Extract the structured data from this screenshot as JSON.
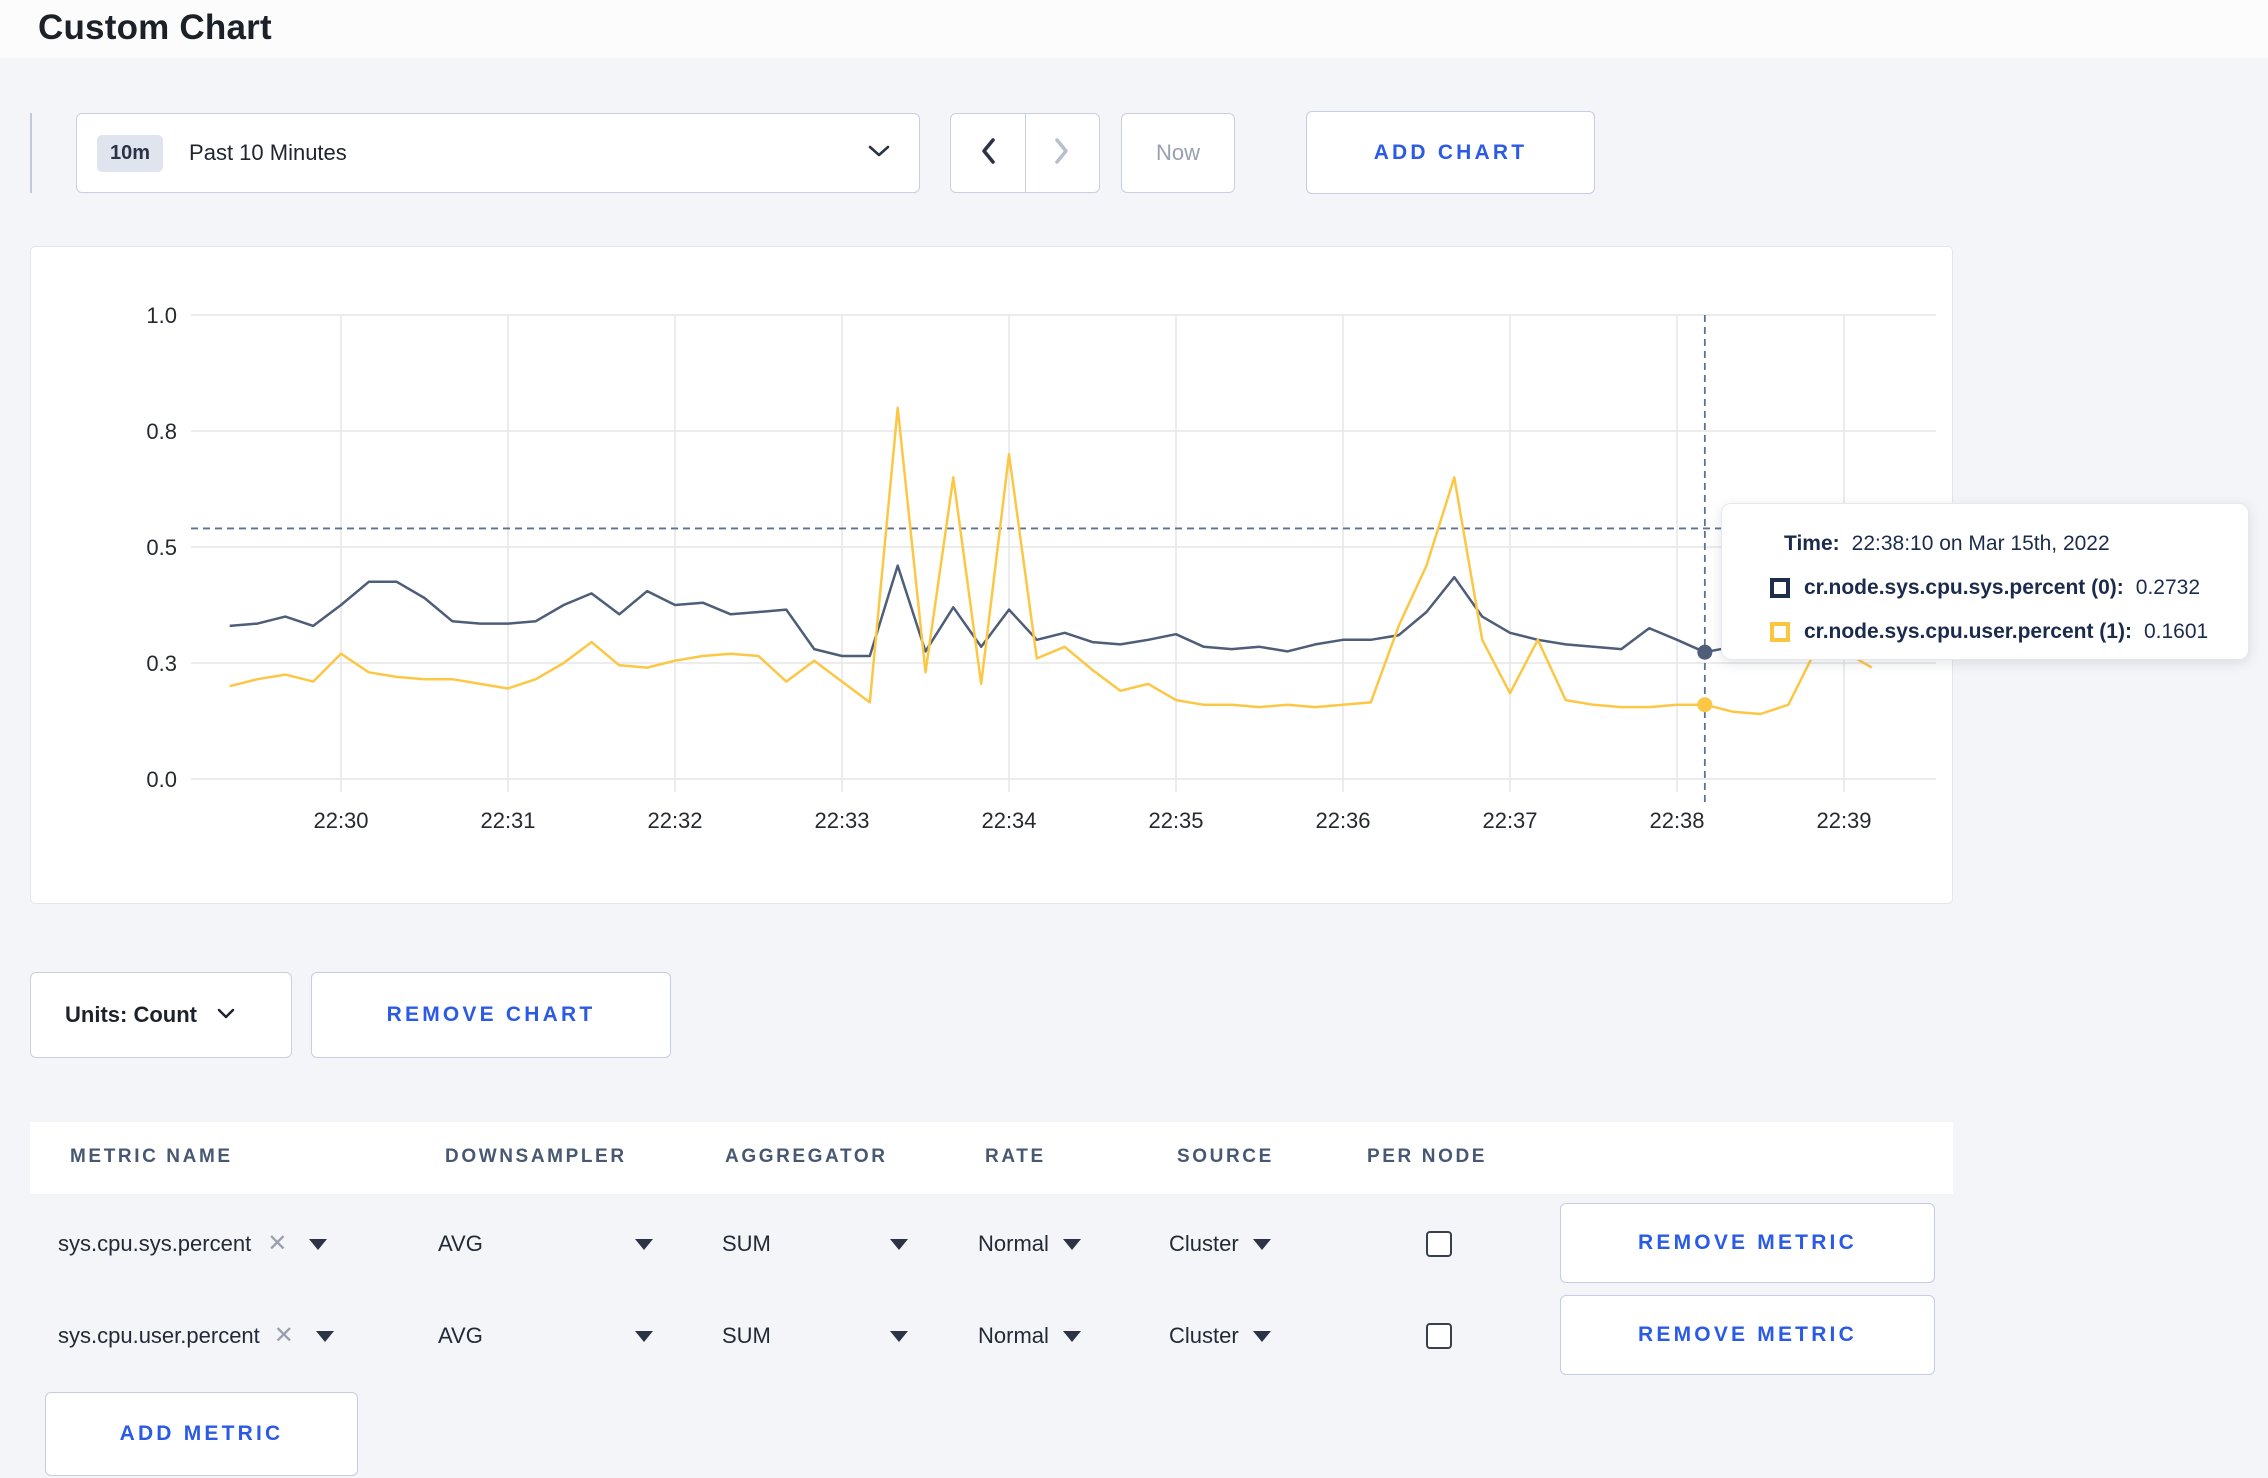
{
  "page": {
    "title": "Custom Chart"
  },
  "toolbar": {
    "time_badge": "10m",
    "time_label": "Past 10 Minutes",
    "now_label": "Now",
    "add_chart_label": "ADD CHART"
  },
  "colors": {
    "accent_blue": "#2b5be6",
    "sys_line": "#4e5d78",
    "user_line": "#fcc745",
    "sys_legend_square": "#1f2d4d",
    "user_legend_square": "#fdc53d",
    "crosshair": "#5d7292",
    "gridline": "#e6e6e6"
  },
  "chart_data": {
    "type": "line",
    "title": "",
    "xlabel": "",
    "ylabel": "",
    "ylim": [
      0,
      1
    ],
    "grid": true,
    "legend_position": "tooltip-only",
    "x_ticks": [
      "22:30",
      "22:31",
      "22:32",
      "22:33",
      "22:34",
      "22:35",
      "22:36",
      "22:37",
      "22:38",
      "22:39"
    ],
    "y_tick_labels": [
      "0.0",
      "0.3",
      "0.5",
      "0.8",
      "1.0"
    ],
    "y_tick_values": [
      0,
      0.25,
      0.5,
      0.75,
      1.0
    ],
    "x_start_time": "22:29:20",
    "x_step_seconds": 10,
    "date": "Mar 15th, 2022",
    "series": [
      {
        "name": "cr.node.sys.cpu.sys.percent (0)",
        "color": "#4e5d78",
        "values": [
          0.33,
          0.335,
          0.35,
          0.33,
          0.375,
          0.425,
          0.425,
          0.39,
          0.34,
          0.335,
          0.335,
          0.34,
          0.375,
          0.4,
          0.355,
          0.405,
          0.375,
          0.38,
          0.355,
          0.36,
          0.365,
          0.28,
          0.265,
          0.265,
          0.46,
          0.275,
          0.37,
          0.285,
          0.365,
          0.3,
          0.315,
          0.295,
          0.29,
          0.3,
          0.312,
          0.285,
          0.28,
          0.285,
          0.275,
          0.29,
          0.3,
          0.3,
          0.31,
          0.36,
          0.435,
          0.35,
          0.315,
          0.3,
          0.29,
          0.285,
          0.28,
          0.325,
          0.3,
          0.2732,
          0.285,
          0.3,
          0.325,
          0.315,
          0.3,
          0.31
        ]
      },
      {
        "name": "cr.node.sys.cpu.user.percent (1)",
        "color": "#fcc745",
        "values": [
          0.2,
          0.215,
          0.225,
          0.21,
          0.27,
          0.23,
          0.22,
          0.215,
          0.215,
          0.205,
          0.195,
          0.215,
          0.25,
          0.295,
          0.245,
          0.24,
          0.255,
          0.265,
          0.27,
          0.265,
          0.21,
          0.255,
          0.21,
          0.165,
          0.8,
          0.23,
          0.65,
          0.205,
          0.7,
          0.26,
          0.285,
          0.235,
          0.19,
          0.205,
          0.17,
          0.16,
          0.16,
          0.155,
          0.16,
          0.155,
          0.16,
          0.165,
          0.33,
          0.46,
          0.65,
          0.3,
          0.185,
          0.3,
          0.17,
          0.16,
          0.155,
          0.155,
          0.16,
          0.1601,
          0.145,
          0.14,
          0.16,
          0.28,
          0.275,
          0.24
        ]
      }
    ],
    "crosshair": {
      "index": 53,
      "time": "22:38:10",
      "hover_value": 0.54
    }
  },
  "tooltip": {
    "time_label": "Time:",
    "time_value": "22:38:10 on Mar 15th, 2022",
    "series": [
      {
        "label": "cr.node.sys.cpu.sys.percent (0):",
        "value": "0.2732",
        "square_color": "#1f2d4d"
      },
      {
        "label": "cr.node.sys.cpu.user.percent (1):",
        "value": "0.1601",
        "square_color": "#fdc53d"
      }
    ]
  },
  "chart_controls": {
    "units_label": "Units: Count",
    "remove_chart_label": "REMOVE CHART"
  },
  "metrics_table": {
    "headers": [
      "METRIC NAME",
      "DOWNSAMPLER",
      "AGGREGATOR",
      "RATE",
      "SOURCE",
      "PER NODE"
    ],
    "rows": [
      {
        "metric": "sys.cpu.sys.percent",
        "downsampler": "AVG",
        "aggregator": "SUM",
        "rate": "Normal",
        "source": "Cluster",
        "per_node_checked": false,
        "remove_label": "REMOVE METRIC"
      },
      {
        "metric": "sys.cpu.user.percent",
        "downsampler": "AVG",
        "aggregator": "SUM",
        "rate": "Normal",
        "source": "Cluster",
        "per_node_checked": false,
        "remove_label": "REMOVE METRIC"
      }
    ],
    "add_metric_label": "ADD METRIC"
  }
}
